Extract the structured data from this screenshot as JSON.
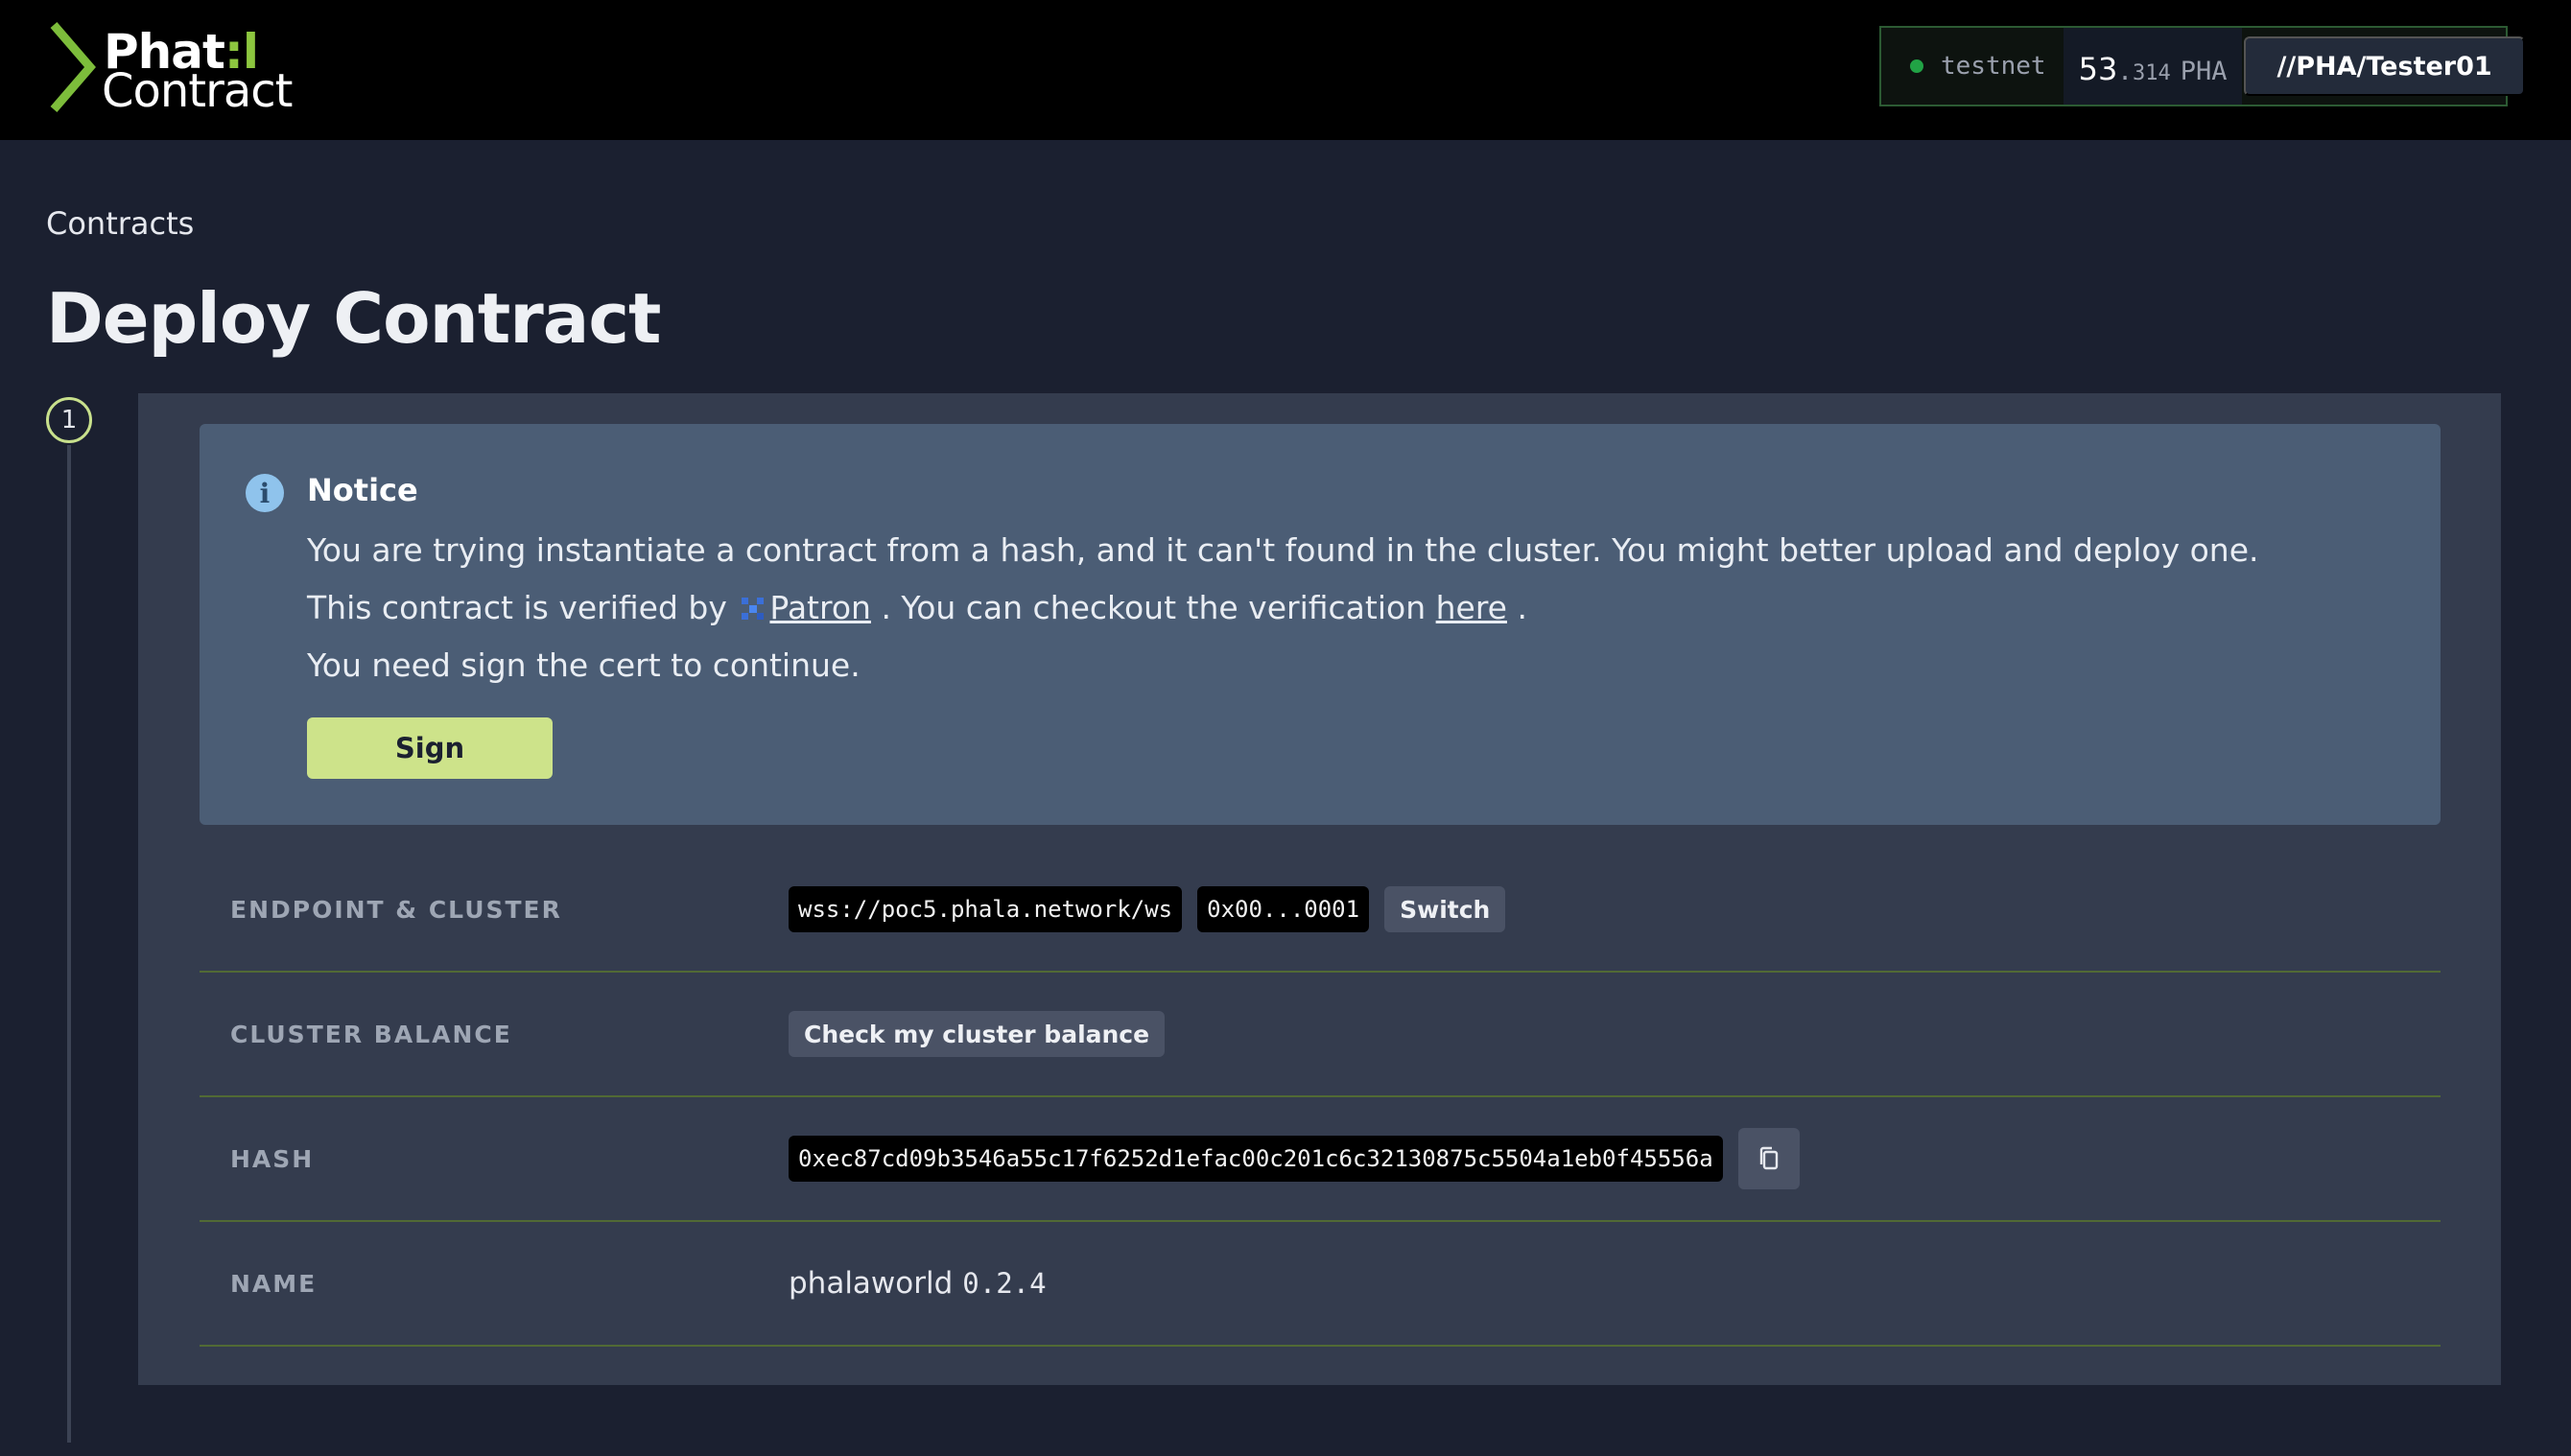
{
  "header": {
    "logo_line1": "Phat",
    "logo_bar": ":l",
    "logo_line2": "Contract",
    "network": "testnet",
    "balance_int": "53",
    "balance_dot": ".",
    "balance_frac": "314",
    "balance_unit": "PHA",
    "account": "//PHA/Tester01"
  },
  "breadcrumb": "Contracts",
  "page_title": "Deploy Contract",
  "step": "1",
  "notice": {
    "title": "Notice",
    "line1": "You are trying instantiate a contract from a hash, and it can't found in the cluster. You might better upload and deploy one.",
    "line2_prefix": "This contract is verified by",
    "patron_link": "Patron",
    "line2_mid": ". You can checkout the verification",
    "here_link": "here",
    "line2_suffix": ".",
    "line3": "You need sign the cert to continue.",
    "sign_label": "Sign"
  },
  "rows": {
    "endpoint": {
      "label": "ENDPOINT & CLUSTER",
      "endpoint_value": "wss://poc5.phala.network/ws",
      "cluster_value": "0x00...0001",
      "switch_label": "Switch"
    },
    "balance": {
      "label": "CLUSTER BALANCE",
      "button_label": "Check my cluster balance"
    },
    "hash": {
      "label": "HASH",
      "value": "0xec87cd09b3546a55c17f6252d1efac00c201c6c32130875c5504a1eb0f45556a"
    },
    "name": {
      "label": "NAME",
      "value": "phalaworld",
      "version": "0.2.4"
    }
  },
  "colors": {
    "accent_green": "#cde38a",
    "status_dot": "#21a345",
    "notice_bg": "#4b5d75"
  },
  "icons": [
    "chevron-logo-icon",
    "info-icon",
    "patron-icon",
    "copy-icon"
  ]
}
